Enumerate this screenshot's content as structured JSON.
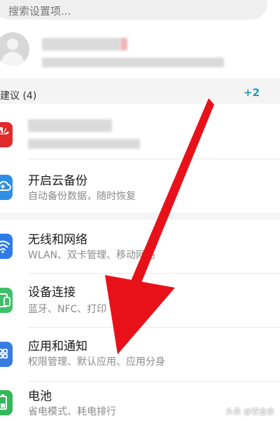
{
  "search": {
    "placeholder": "搜索设置项..."
  },
  "suggestions": {
    "title": "建议 (4)",
    "count": "+2"
  },
  "cloud": {
    "title": "开启云备份",
    "subtitle": "自动备份数据，随时恢复"
  },
  "items": [
    {
      "title": "无线和网络",
      "subtitle": "WLAN、双卡管理、移动网络",
      "icon": "wifi-icon",
      "color": "#2f7ce8"
    },
    {
      "title": "设备连接",
      "subtitle": "蓝牙、NFC、打印",
      "icon": "device-connection-icon",
      "color": "#3fbf6a"
    },
    {
      "title": "应用和通知",
      "subtitle": "权限管理、默认应用、应用分身",
      "icon": "apps-grid-icon",
      "color": "#3a7be0"
    },
    {
      "title": "电池",
      "subtitle": "省电模式、耗电排行",
      "icon": "battery-icon",
      "color": "#34b85a"
    }
  ],
  "colors": {
    "accent": "#2a9cb0",
    "arrow": "#e8111a",
    "huawei": "#e02a2a",
    "cloud": "#2f8fe6"
  },
  "watermark": "头条 @农金余"
}
